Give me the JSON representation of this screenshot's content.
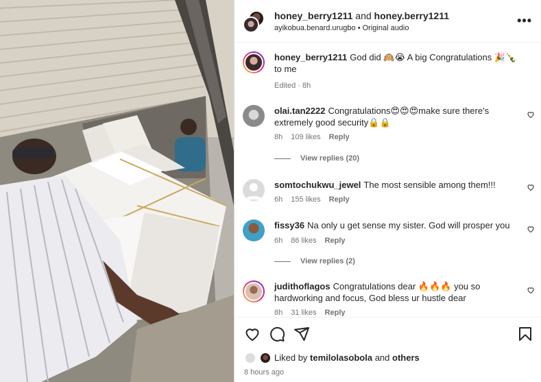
{
  "header": {
    "user1": "honey_berry1211",
    "and_text": " and ",
    "user2": "honey.berry1211",
    "subtitle": "ayikobua.benard.urugbo • Original audio",
    "more_icon": "more-horizontal-icon"
  },
  "caption": {
    "user": "honey_berry1211",
    "text": "God did 🙉😭 A big Congratulations 🎉🍾 to me",
    "meta": "Edited · 8h"
  },
  "comments": [
    {
      "user": "olai.tan2222",
      "text": "Congratulations😍😍😍make sure there's extremely good security🔒🔒",
      "time": "8h",
      "likes": "109 likes",
      "reply": "Reply",
      "view_replies": "View replies (20)"
    },
    {
      "user": "somtochukwu_jewel",
      "text": "The most sensible among them!!!",
      "time": "6h",
      "likes": "155 likes",
      "reply": "Reply"
    },
    {
      "user": "fissy36",
      "text": "Na only u get sense my sister. God will prosper you",
      "time": "6h",
      "likes": "86 likes",
      "reply": "Reply",
      "view_replies": "View replies (2)"
    },
    {
      "user": "judithoflagos",
      "text": "Congratulations dear 🔥🔥🔥 you so hardworking and focus, God bless ur hustle dear",
      "time": "8h",
      "likes": "31 likes",
      "reply": "Reply"
    }
  ],
  "actions": {
    "like_icon": "heart-icon",
    "comment_icon": "comment-icon",
    "share_icon": "send-icon",
    "save_icon": "bookmark-icon"
  },
  "likes": {
    "prefix": "Liked by ",
    "user": "temilolasobola",
    "and_text": " and ",
    "others": "others"
  },
  "time_ago": "8 hours ago",
  "colors": {
    "text": "#262626",
    "secondary": "#737373",
    "border": "#dbdbdb"
  }
}
